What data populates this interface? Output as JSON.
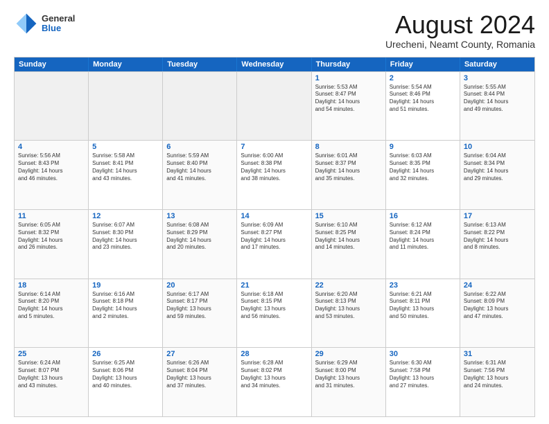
{
  "header": {
    "logo_general": "General",
    "logo_blue": "Blue",
    "title": "August 2024",
    "subtitle": "Urecheni, Neamt County, Romania"
  },
  "days": [
    "Sunday",
    "Monday",
    "Tuesday",
    "Wednesday",
    "Thursday",
    "Friday",
    "Saturday"
  ],
  "weeks": [
    [
      {
        "day": "",
        "text": ""
      },
      {
        "day": "",
        "text": ""
      },
      {
        "day": "",
        "text": ""
      },
      {
        "day": "",
        "text": ""
      },
      {
        "day": "1",
        "text": "Sunrise: 5:53 AM\nSunset: 8:47 PM\nDaylight: 14 hours\nand 54 minutes."
      },
      {
        "day": "2",
        "text": "Sunrise: 5:54 AM\nSunset: 8:46 PM\nDaylight: 14 hours\nand 51 minutes."
      },
      {
        "day": "3",
        "text": "Sunrise: 5:55 AM\nSunset: 8:44 PM\nDaylight: 14 hours\nand 49 minutes."
      }
    ],
    [
      {
        "day": "4",
        "text": "Sunrise: 5:56 AM\nSunset: 8:43 PM\nDaylight: 14 hours\nand 46 minutes."
      },
      {
        "day": "5",
        "text": "Sunrise: 5:58 AM\nSunset: 8:41 PM\nDaylight: 14 hours\nand 43 minutes."
      },
      {
        "day": "6",
        "text": "Sunrise: 5:59 AM\nSunset: 8:40 PM\nDaylight: 14 hours\nand 41 minutes."
      },
      {
        "day": "7",
        "text": "Sunrise: 6:00 AM\nSunset: 8:38 PM\nDaylight: 14 hours\nand 38 minutes."
      },
      {
        "day": "8",
        "text": "Sunrise: 6:01 AM\nSunset: 8:37 PM\nDaylight: 14 hours\nand 35 minutes."
      },
      {
        "day": "9",
        "text": "Sunrise: 6:03 AM\nSunset: 8:35 PM\nDaylight: 14 hours\nand 32 minutes."
      },
      {
        "day": "10",
        "text": "Sunrise: 6:04 AM\nSunset: 8:34 PM\nDaylight: 14 hours\nand 29 minutes."
      }
    ],
    [
      {
        "day": "11",
        "text": "Sunrise: 6:05 AM\nSunset: 8:32 PM\nDaylight: 14 hours\nand 26 minutes."
      },
      {
        "day": "12",
        "text": "Sunrise: 6:07 AM\nSunset: 8:30 PM\nDaylight: 14 hours\nand 23 minutes."
      },
      {
        "day": "13",
        "text": "Sunrise: 6:08 AM\nSunset: 8:29 PM\nDaylight: 14 hours\nand 20 minutes."
      },
      {
        "day": "14",
        "text": "Sunrise: 6:09 AM\nSunset: 8:27 PM\nDaylight: 14 hours\nand 17 minutes."
      },
      {
        "day": "15",
        "text": "Sunrise: 6:10 AM\nSunset: 8:25 PM\nDaylight: 14 hours\nand 14 minutes."
      },
      {
        "day": "16",
        "text": "Sunrise: 6:12 AM\nSunset: 8:24 PM\nDaylight: 14 hours\nand 11 minutes."
      },
      {
        "day": "17",
        "text": "Sunrise: 6:13 AM\nSunset: 8:22 PM\nDaylight: 14 hours\nand 8 minutes."
      }
    ],
    [
      {
        "day": "18",
        "text": "Sunrise: 6:14 AM\nSunset: 8:20 PM\nDaylight: 14 hours\nand 5 minutes."
      },
      {
        "day": "19",
        "text": "Sunrise: 6:16 AM\nSunset: 8:18 PM\nDaylight: 14 hours\nand 2 minutes."
      },
      {
        "day": "20",
        "text": "Sunrise: 6:17 AM\nSunset: 8:17 PM\nDaylight: 13 hours\nand 59 minutes."
      },
      {
        "day": "21",
        "text": "Sunrise: 6:18 AM\nSunset: 8:15 PM\nDaylight: 13 hours\nand 56 minutes."
      },
      {
        "day": "22",
        "text": "Sunrise: 6:20 AM\nSunset: 8:13 PM\nDaylight: 13 hours\nand 53 minutes."
      },
      {
        "day": "23",
        "text": "Sunrise: 6:21 AM\nSunset: 8:11 PM\nDaylight: 13 hours\nand 50 minutes."
      },
      {
        "day": "24",
        "text": "Sunrise: 6:22 AM\nSunset: 8:09 PM\nDaylight: 13 hours\nand 47 minutes."
      }
    ],
    [
      {
        "day": "25",
        "text": "Sunrise: 6:24 AM\nSunset: 8:07 PM\nDaylight: 13 hours\nand 43 minutes."
      },
      {
        "day": "26",
        "text": "Sunrise: 6:25 AM\nSunset: 8:06 PM\nDaylight: 13 hours\nand 40 minutes."
      },
      {
        "day": "27",
        "text": "Sunrise: 6:26 AM\nSunset: 8:04 PM\nDaylight: 13 hours\nand 37 minutes."
      },
      {
        "day": "28",
        "text": "Sunrise: 6:28 AM\nSunset: 8:02 PM\nDaylight: 13 hours\nand 34 minutes."
      },
      {
        "day": "29",
        "text": "Sunrise: 6:29 AM\nSunset: 8:00 PM\nDaylight: 13 hours\nand 31 minutes."
      },
      {
        "day": "30",
        "text": "Sunrise: 6:30 AM\nSunset: 7:58 PM\nDaylight: 13 hours\nand 27 minutes."
      },
      {
        "day": "31",
        "text": "Sunrise: 6:31 AM\nSunset: 7:56 PM\nDaylight: 13 hours\nand 24 minutes."
      }
    ]
  ]
}
